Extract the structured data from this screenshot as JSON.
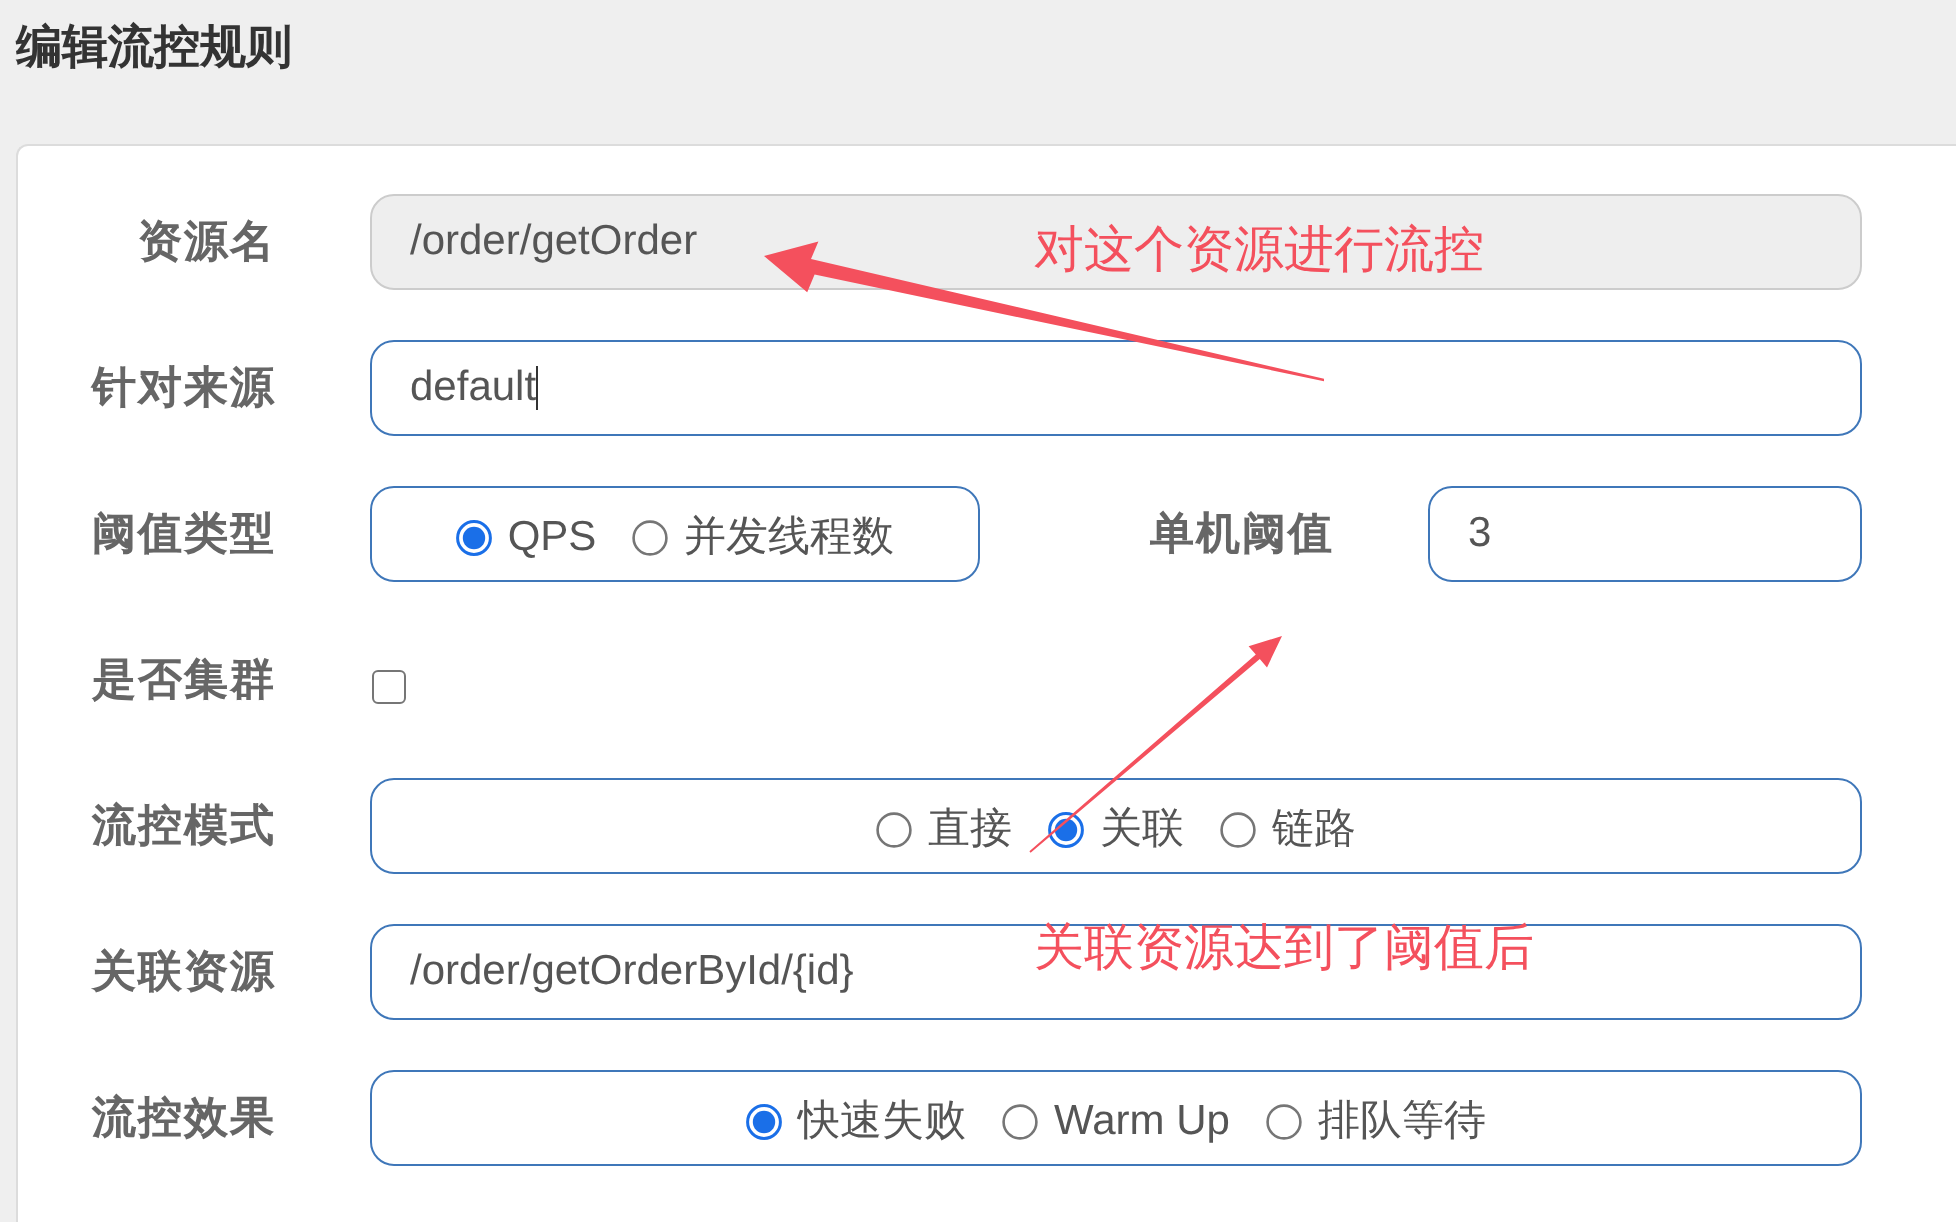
{
  "page": {
    "title": "编辑流控规则"
  },
  "form": {
    "rows": [
      {
        "kind": "text",
        "label": "资源名",
        "value": "/order/getOrder",
        "disabled": true,
        "focused": false
      },
      {
        "kind": "text",
        "label": "针对来源",
        "value": "default",
        "disabled": false,
        "focused": true
      },
      {
        "kind": "radio",
        "label": "阈值类型",
        "options": [
          {
            "label": "QPS",
            "selected": true
          },
          {
            "label": "并发线程数",
            "selected": false
          }
        ],
        "side_field": {
          "label": "单机阈值",
          "value": "3"
        }
      },
      {
        "kind": "checkbox",
        "label": "是否集群",
        "checked": false
      },
      {
        "kind": "radio",
        "label": "流控模式",
        "options": [
          {
            "label": "直接",
            "selected": false
          },
          {
            "label": "关联",
            "selected": true
          },
          {
            "label": "链路",
            "selected": false
          }
        ]
      },
      {
        "kind": "text",
        "label": "关联资源",
        "value": "/order/getOrderById/{id}",
        "disabled": false,
        "focused": false
      },
      {
        "kind": "radio",
        "label": "流控效果",
        "options": [
          {
            "label": "快速失败",
            "selected": true
          },
          {
            "label": "Warm Up",
            "selected": false
          },
          {
            "label": "排队等待",
            "selected": false
          }
        ]
      }
    ]
  },
  "annotations": [
    {
      "text": "对这个资源进行流控"
    },
    {
      "text": "关联资源达到了阈值后"
    }
  ]
}
